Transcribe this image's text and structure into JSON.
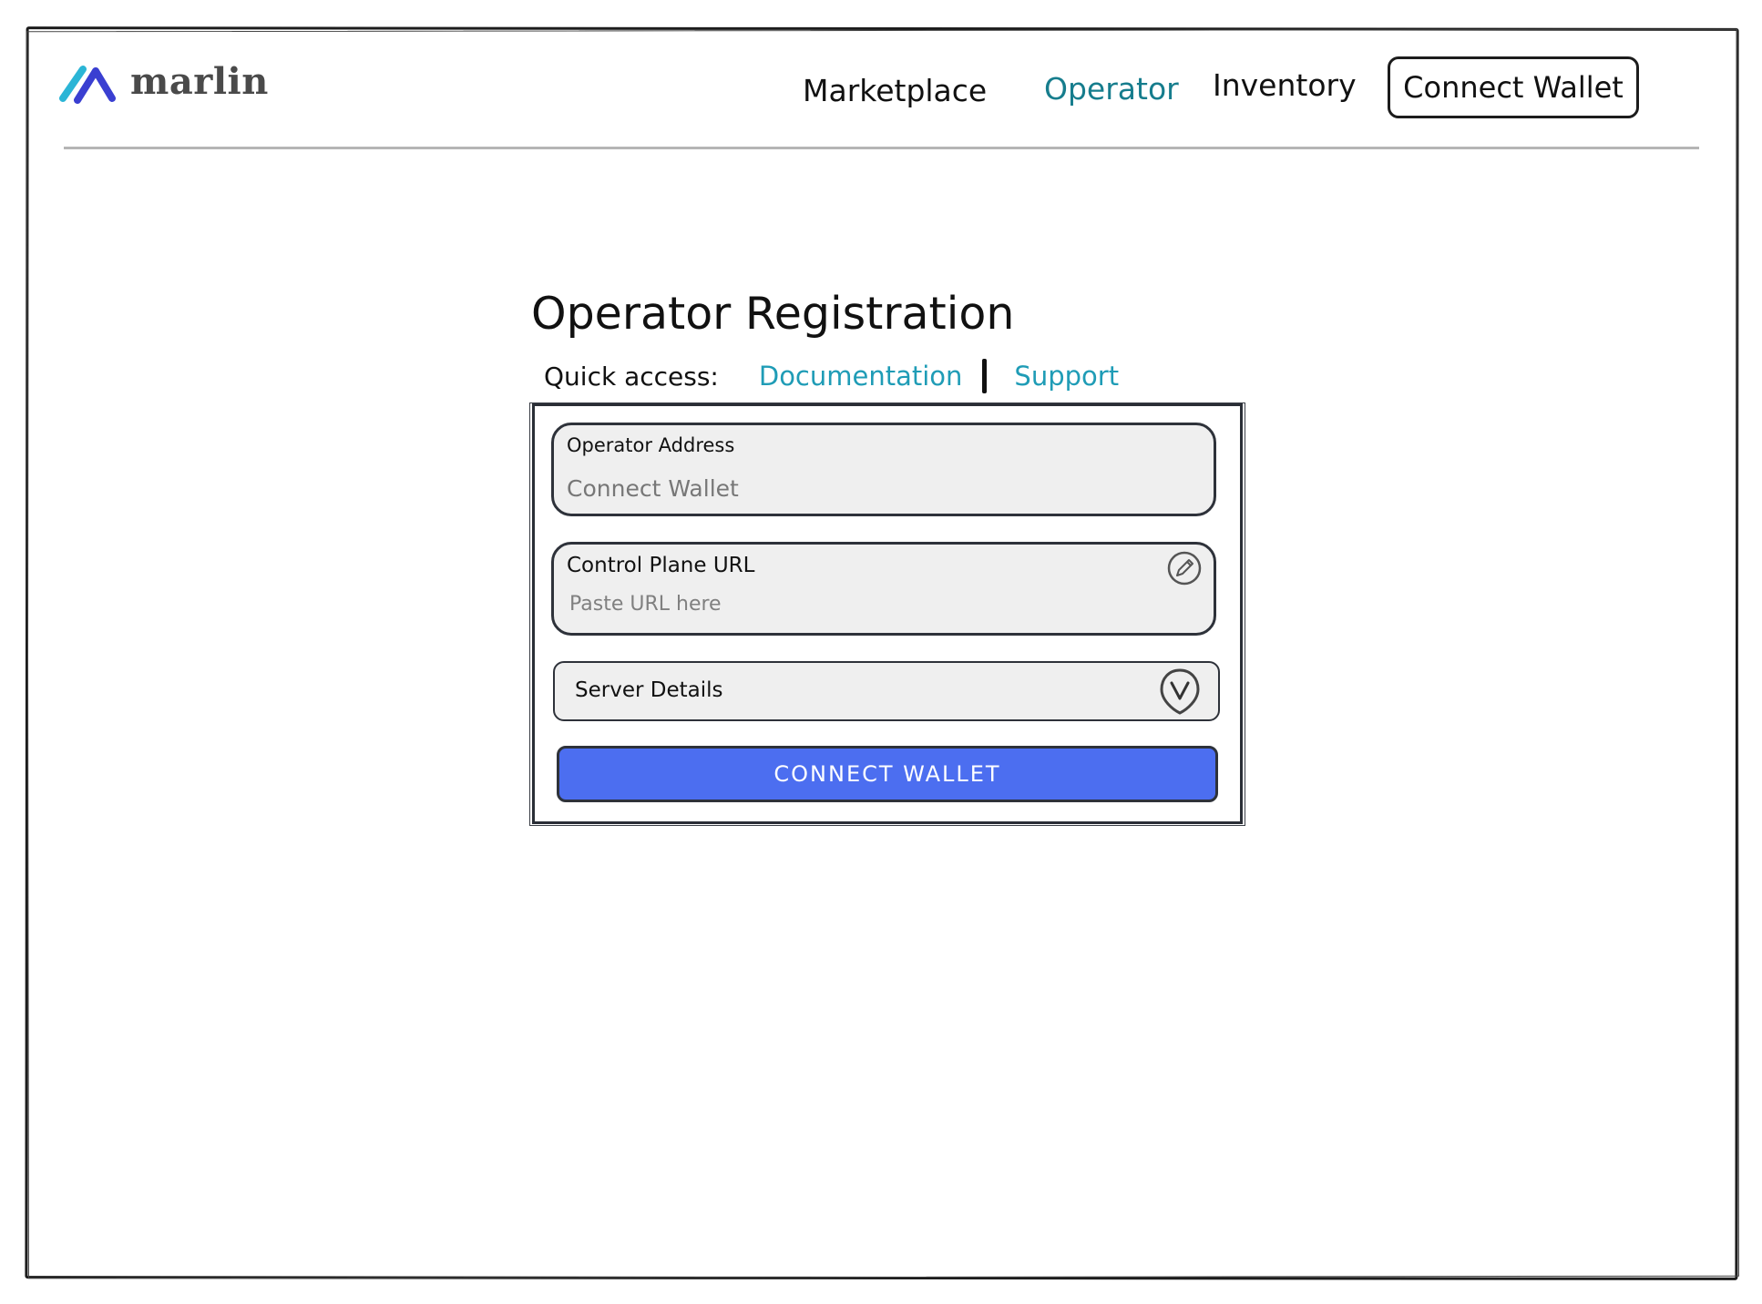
{
  "brand": {
    "name": "marlin",
    "colors": {
      "mark_light": "#2bb5d6",
      "mark_dark": "#3a3fd1",
      "text": "#4a4a4a"
    }
  },
  "nav": {
    "items": [
      {
        "label": "Marketplace",
        "active": false
      },
      {
        "label": "Operator",
        "active": true
      },
      {
        "label": "Inventory",
        "active": false
      }
    ],
    "connect_label": "Connect Wallet",
    "active_color": "#167d8d"
  },
  "page": {
    "title": "Operator Registration",
    "quick_access": {
      "label": "Quick access:",
      "links": [
        "Documentation",
        "Support"
      ],
      "link_color": "#1f9cb6"
    }
  },
  "form": {
    "operator_address": {
      "label": "Operator Address",
      "value": "Connect Wallet"
    },
    "control_plane_url": {
      "label": "Control Plane URL",
      "placeholder": "Paste URL here",
      "icon": "pencil-icon"
    },
    "server_details": {
      "label": "Server Details",
      "icon": "chevron-down-icon"
    },
    "submit_label": "CONNECT WALLET",
    "submit_color": "#4c6ef0"
  }
}
